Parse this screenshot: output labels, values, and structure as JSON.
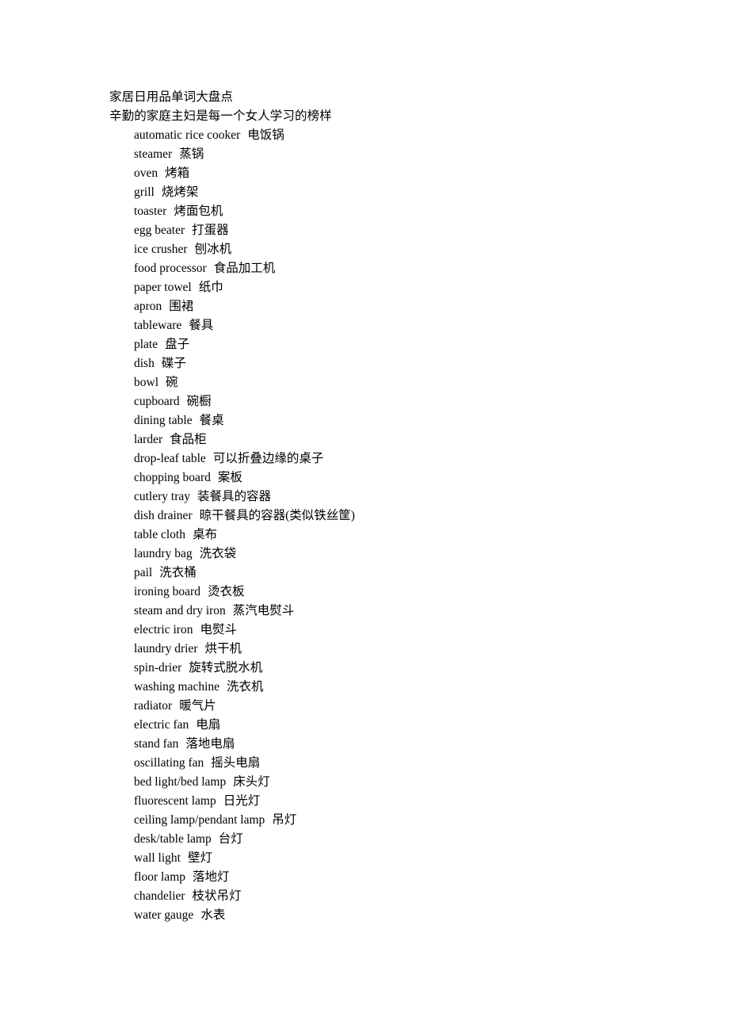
{
  "document": {
    "headings": [
      "家居日用品单词大盘点",
      "辛勤的家庭主妇是每一个女人学习的榜样"
    ],
    "entries": [
      {
        "en": "automatic rice cooker",
        "zh": "电饭锅"
      },
      {
        "en": "steamer",
        "zh": "蒸锅"
      },
      {
        "en": "oven",
        "zh": "烤箱"
      },
      {
        "en": "grill",
        "zh": "烧烤架"
      },
      {
        "en": "toaster",
        "zh": "烤面包机"
      },
      {
        "en": "egg beater",
        "zh": "打蛋器"
      },
      {
        "en": "ice crusher",
        "zh": "刨冰机"
      },
      {
        "en": "food processor",
        "zh": "食品加工机"
      },
      {
        "en": "paper towel",
        "zh": "纸巾"
      },
      {
        "en": "apron",
        "zh": "围裙"
      },
      {
        "en": "tableware",
        "zh": "餐具"
      },
      {
        "en": "plate",
        "zh": "盘子"
      },
      {
        "en": "dish",
        "zh": "碟子"
      },
      {
        "en": "bowl",
        "zh": "碗"
      },
      {
        "en": "cupboard",
        "zh": "碗橱"
      },
      {
        "en": "dining table",
        "zh": "餐桌"
      },
      {
        "en": "larder",
        "zh": "食品柜"
      },
      {
        "en": "drop-leaf table",
        "zh": "可以折叠边缘的桌子"
      },
      {
        "en": "chopping board",
        "zh": "案板"
      },
      {
        "en": "cutlery tray",
        "zh": "装餐具的容器"
      },
      {
        "en": "dish drainer",
        "zh": "晾干餐具的容器(类似铁丝筐)"
      },
      {
        "en": "table cloth",
        "zh": "桌布"
      },
      {
        "en": "laundry bag",
        "zh": "洗衣袋"
      },
      {
        "en": "pail",
        "zh": "洗衣桶"
      },
      {
        "en": "ironing board",
        "zh": "烫衣板"
      },
      {
        "en": "steam and dry iron",
        "zh": "蒸汽电熨斗"
      },
      {
        "en": "electric iron",
        "zh": "电熨斗"
      },
      {
        "en": "laundry drier",
        "zh": "烘干机"
      },
      {
        "en": "spin-drier",
        "zh": "旋转式脱水机"
      },
      {
        "en": "washing machine",
        "zh": "洗衣机"
      },
      {
        "en": "radiator",
        "zh": "暖气片"
      },
      {
        "en": "electric fan",
        "zh": "电扇"
      },
      {
        "en": "stand fan",
        "zh": "落地电扇"
      },
      {
        "en": "oscillating fan",
        "zh": "摇头电扇"
      },
      {
        "en": "bed light/bed lamp",
        "zh": "床头灯"
      },
      {
        "en": "fluorescent lamp",
        "zh": "日光灯"
      },
      {
        "en": "ceiling lamp/pendant lamp",
        "zh": "吊灯"
      },
      {
        "en": "desk/table lamp",
        "zh": "台灯"
      },
      {
        "en": "wall light",
        "zh": "壁灯"
      },
      {
        "en": "floor lamp",
        "zh": "落地灯"
      },
      {
        "en": "chandelier",
        "zh": "枝状吊灯"
      },
      {
        "en": "water gauge",
        "zh": "水表"
      }
    ]
  },
  "colors": {
    "text": "#000000",
    "page_background": "#ffffff"
  }
}
